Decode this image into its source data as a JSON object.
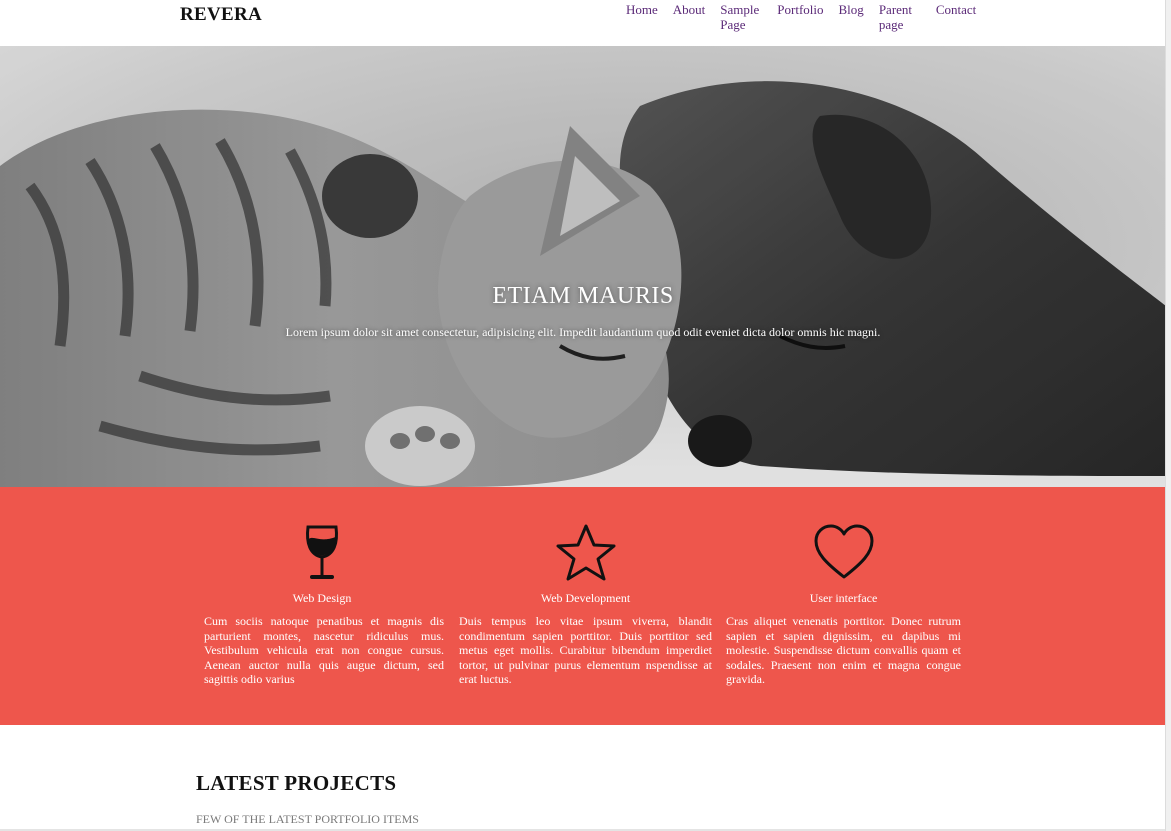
{
  "site": {
    "brand": "REVERA"
  },
  "nav": {
    "items": [
      {
        "label": "Home"
      },
      {
        "label": "About"
      },
      {
        "label": "Sample Page"
      },
      {
        "label": "Portfolio"
      },
      {
        "label": "Blog"
      },
      {
        "label": "Parent page"
      },
      {
        "label": "Contact"
      }
    ],
    "color": "#5b2a78"
  },
  "hero": {
    "title": "ETIAM MAURIS",
    "subtitle": "Lorem ipsum dolor sit amet consectetur, adipisicing elit. Impedit laudantium quod odit eveniet dicta dolor omnis hic magni.",
    "image": "sleeping-kitten-and-puppy-photo"
  },
  "services": {
    "background": "#ee564c",
    "items": [
      {
        "icon": "wine-glass-icon",
        "title": "Web Design",
        "text": "Cum sociis natoque penatibus et magnis dis parturient montes, nascetur ridiculus mus. Vestibulum vehicula erat non congue cursus. Aenean auctor nulla quis augue dictum, sed sagittis odio varius"
      },
      {
        "icon": "star-icon",
        "title": "Web Development",
        "text": "Duis tempus leo vitae ipsum viverra, blandit condimentum sapien porttitor. Duis porttitor sed metus eget mollis. Curabitur bibendum imperdiet tortor, ut pulvinar purus elementum nspendisse at erat luctus."
      },
      {
        "icon": "heart-icon",
        "title": "User interface",
        "text": "Cras aliquet venenatis porttitor. Donec rutrum sapien et sapien dignissim, eu dapibus mi molestie. Suspendisse dictum convallis quam et sodales. Praesent non enim et magna congue gravida."
      }
    ]
  },
  "projects": {
    "title": "LATEST PROJECTS",
    "subtitle": "FEW OF THE LATEST PORTFOLIO ITEMS"
  }
}
